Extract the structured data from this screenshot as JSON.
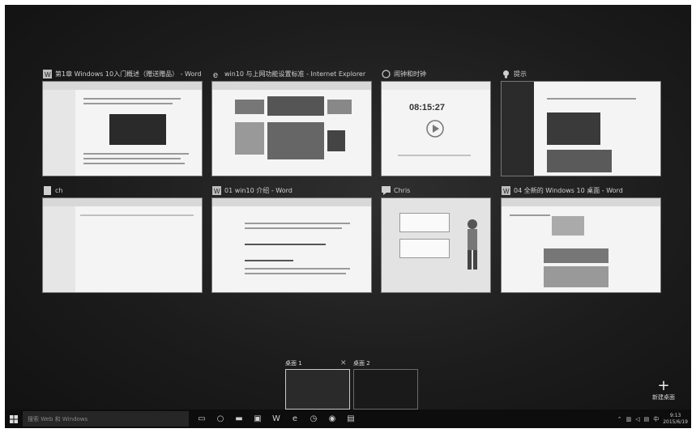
{
  "windows": [
    {
      "title": "第1章 Windows 10入门概述（赠送赠品） - Word",
      "icon": "word-icon"
    },
    {
      "title": "win10 与上网功能设置标准 - Internet Explorer",
      "icon": "ie-icon"
    },
    {
      "title": "闹钟和时钟",
      "icon": "alarm-icon"
    },
    {
      "title": "提示",
      "icon": "tips-icon"
    },
    {
      "title": "ch",
      "icon": "document-icon"
    },
    {
      "title": "01 win10 介绍 - Word",
      "icon": "word-icon"
    },
    {
      "title": "Chris",
      "icon": "chat-icon"
    },
    {
      "title": "04 全新的 Windows 10 桌面 - Word",
      "icon": "word-icon"
    }
  ],
  "alarm": {
    "time": "08:15:27"
  },
  "desktops": {
    "d1_label": "桌面 1",
    "d2_label": "桌面 2",
    "new_label": "新建桌面"
  },
  "taskbar": {
    "search_placeholder": "搜索 Web 和 Windows",
    "time": "9:13",
    "date": "2015/6/19"
  }
}
